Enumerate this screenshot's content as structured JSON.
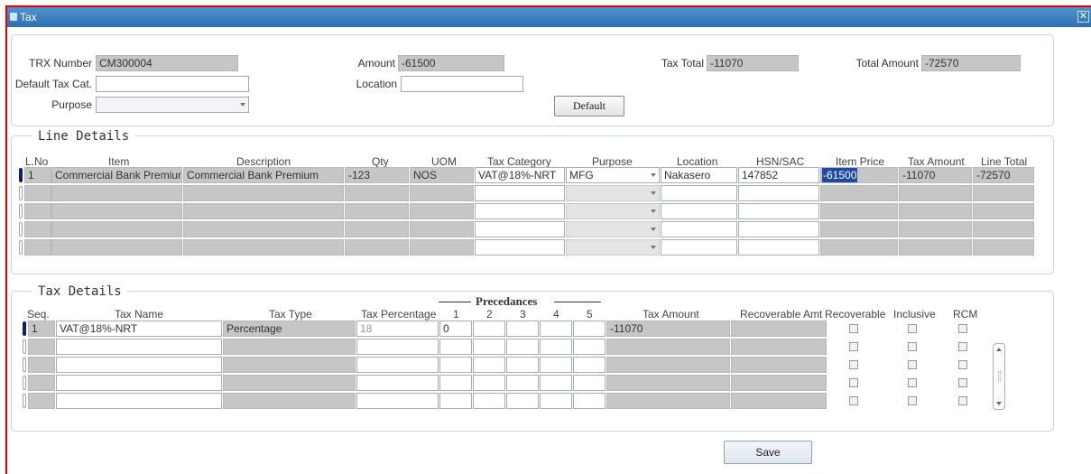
{
  "window": {
    "title": "Tax",
    "close_glyph": "✕"
  },
  "header": {
    "trx_number": {
      "label": "TRX Number",
      "value": "CM300004"
    },
    "amount": {
      "label": "Amount",
      "value": "-61500"
    },
    "tax_total": {
      "label": "Tax Total",
      "value": "-11070"
    },
    "total_amount": {
      "label": "Total Amount",
      "value": "-72570"
    },
    "default_tax_cat": {
      "label": "Default Tax Cat.",
      "value": ""
    },
    "location": {
      "label": "Location",
      "value": ""
    },
    "purpose": {
      "label": "Purpose",
      "value": ""
    },
    "default_button": "Default"
  },
  "line_details": {
    "title": "Line Details",
    "columns": [
      "L.No",
      "Item",
      "Description",
      "Qty",
      "UOM",
      "Tax Category",
      "Purpose",
      "Location",
      "HSN/SAC",
      "Item Price",
      "Tax Amount",
      "Line Total"
    ],
    "rows": [
      {
        "lno": "1",
        "item": "Commercial Bank Premium",
        "description": "Commercial Bank Premium",
        "qty": "-123",
        "uom": "NOS",
        "tax_category": "VAT@18%-NRT",
        "purpose": "MFG",
        "location": "Nakasero",
        "hsn_sac": "147852",
        "item_price": "-61500",
        "tax_amount": "-11070",
        "line_total": "-72570"
      }
    ]
  },
  "tax_details": {
    "title": "Tax Details",
    "precedances_title": "Precedances",
    "columns": [
      "Seq.",
      "Tax Name",
      "Tax Type",
      "Tax Percentage",
      "1",
      "2",
      "3",
      "4",
      "5",
      "Tax Amount",
      "Recoverable Amt",
      "Recoverable",
      "Inclusive",
      "RCM"
    ],
    "rows": [
      {
        "seq": "1",
        "tax_name": "VAT@18%-NRT",
        "tax_type": "Percentage",
        "tax_percentage": "18",
        "p1": "0",
        "tax_amount": "-11070"
      }
    ]
  },
  "footer": {
    "save_button": "Save"
  },
  "icons": {
    "window": "form-icon",
    "close": "close-icon",
    "scroll_up": "scroll-up-icon",
    "scroll_down": "scroll-down-icon"
  }
}
